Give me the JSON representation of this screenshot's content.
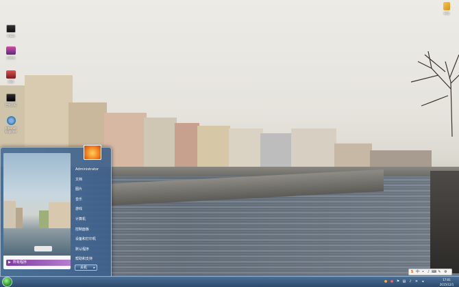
{
  "desktop": {
    "icons": [
      {
        "label": "计算机",
        "icon": "computer-icon"
      },
      {
        "label": "回收站",
        "icon": "recycle-bin-icon"
      },
      {
        "label": "网络",
        "icon": "network-icon"
      },
      {
        "label": "控制面板",
        "icon": "control-panel-icon"
      },
      {
        "label": "Internet Explorer",
        "icon": "ie-icon"
      }
    ],
    "top_right_icon": {
      "label": "网络",
      "icon": "network-icon"
    }
  },
  "start_menu": {
    "user": "Administrator",
    "items": [
      "文档",
      "图片",
      "音乐",
      "游戏",
      "计算机",
      "控制面板",
      "设备和打印机",
      "默认程序",
      "帮助和支持"
    ],
    "all_programs": "所有程序",
    "search_placeholder": "搜索程序和文件",
    "shutdown": "关机"
  },
  "taskbar": {
    "time": "17:01",
    "date": "2015/12/1"
  },
  "ime": {
    "labels": [
      "S",
      "中",
      "•",
      "♪",
      "⌨",
      "✎",
      "⚙"
    ]
  },
  "colors": {
    "taskbar": "#2c4a6d",
    "start_menu": "#466e96",
    "all_programs": "#8a4aaa"
  }
}
